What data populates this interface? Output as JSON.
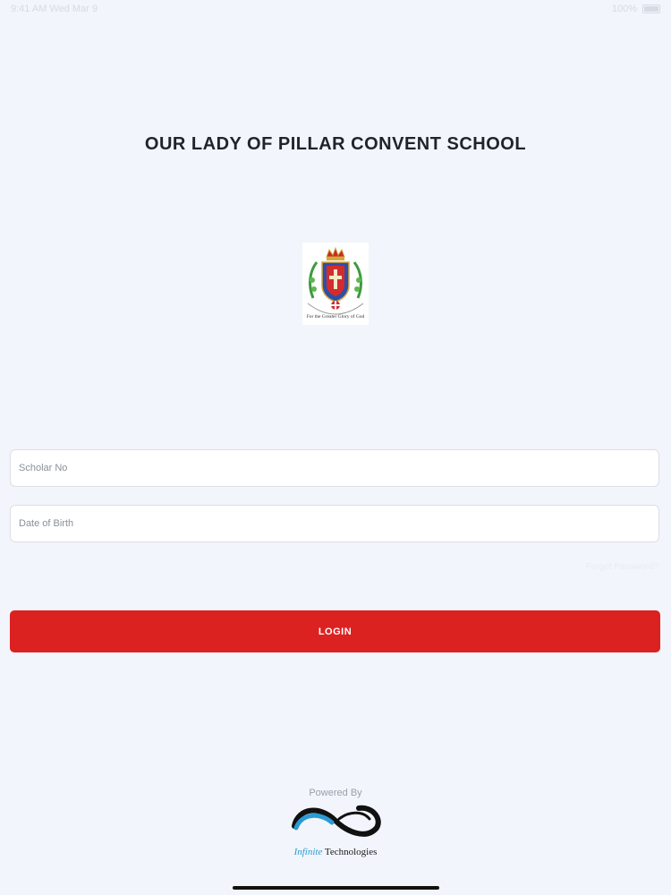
{
  "status_bar": {
    "left_text": "9:41 AM  Wed Mar 9",
    "right_text": "100%"
  },
  "header": {
    "title": "OUR LADY OF PILLAR CONVENT SCHOOL"
  },
  "crest": {
    "motto": "For the Greater Glory of God"
  },
  "form": {
    "scholar_placeholder": "Scholar No",
    "dob_placeholder": "Date of Birth",
    "forgot_label": "Forgot Password?",
    "login_label": "LOGIN"
  },
  "footer": {
    "powered_by": "Powered By",
    "brand_accent": "Infinite",
    "brand_rest": " Technologies"
  },
  "colors": {
    "background": "#f2f5fb",
    "login_button": "#dc2121",
    "brand_blue": "#2a9bd4"
  }
}
